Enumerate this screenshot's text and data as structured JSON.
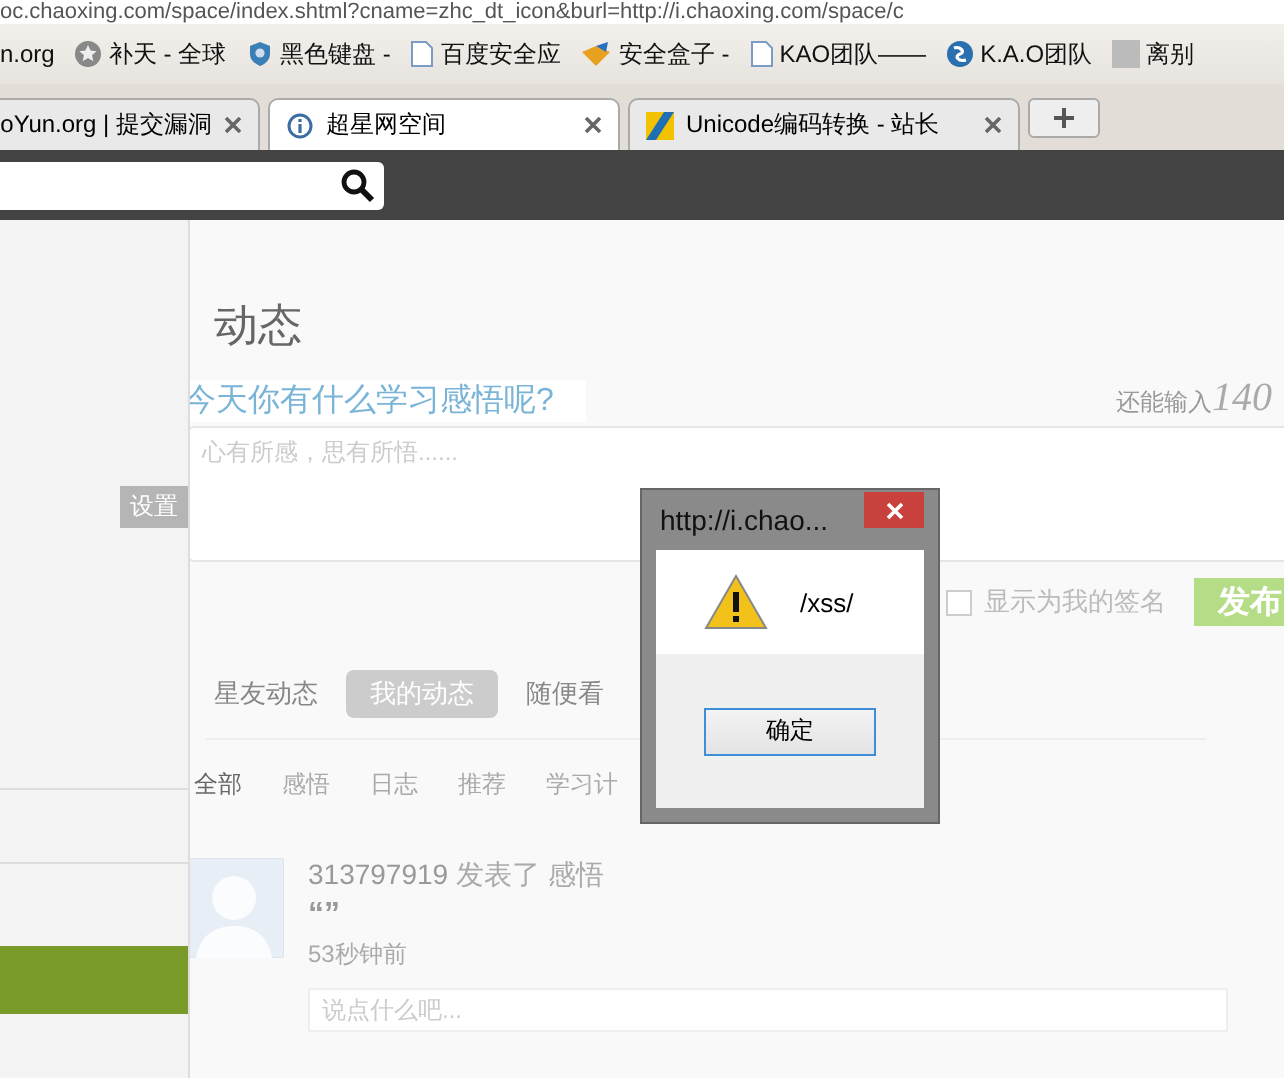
{
  "address_bar": {
    "url": "oc.chaoxing.com/space/index.shtml?cname=zhc_dt_icon&burl=http://i.chaoxing.com/space/c"
  },
  "bookmarks": [
    {
      "label": "n.org",
      "kind": "none"
    },
    {
      "label": "补天 - 全球",
      "kind": "star"
    },
    {
      "label": "黑色键盘 -",
      "kind": "shield"
    },
    {
      "label": "百度安全应",
      "kind": "page"
    },
    {
      "label": "安全盒子 -",
      "kind": "box"
    },
    {
      "label": "KAO团队——",
      "kind": "page"
    },
    {
      "label": "K.A.O团队",
      "kind": "globe"
    },
    {
      "label": "离别",
      "kind": "photo"
    }
  ],
  "tabs": [
    {
      "title": "oYun.org | 提交漏洞",
      "selected": false,
      "kind": "none"
    },
    {
      "title": "超星网空间",
      "selected": true,
      "kind": "info"
    },
    {
      "title": "Unicode编码转换 - 站长",
      "selected": false,
      "kind": "flag"
    }
  ],
  "sidebar": {
    "label": "设置"
  },
  "page": {
    "title": "动态",
    "prompt": "今天你有什么学习感悟呢?",
    "counter_label": "还能输入",
    "counter": "140",
    "post_field": {
      "placeholder": "心有所感，思有所悟......"
    },
    "signature": {
      "label": "显示为我的签名",
      "checked": false
    },
    "publish_button": "发布",
    "feed_tabs": [
      {
        "label": "星友动态",
        "selected": false
      },
      {
        "label": "我的动态",
        "selected": true
      },
      {
        "label": "随便看",
        "selected": false
      }
    ],
    "filters": [
      {
        "label": "全部",
        "selected": true
      },
      {
        "label": "感悟",
        "selected": false
      },
      {
        "label": "日志",
        "selected": false
      },
      {
        "label": "推荐",
        "selected": false
      },
      {
        "label": "学习计",
        "selected": false
      }
    ],
    "posts": [
      {
        "user": "313797919",
        "action": "发表了",
        "category": "感悟",
        "quote": "“”",
        "time": "53秒钟前",
        "comment_placeholder": "说点什么吧..."
      }
    ]
  },
  "dialog": {
    "title": "http://i.chao...",
    "message": "/xss/",
    "button": "确定"
  }
}
